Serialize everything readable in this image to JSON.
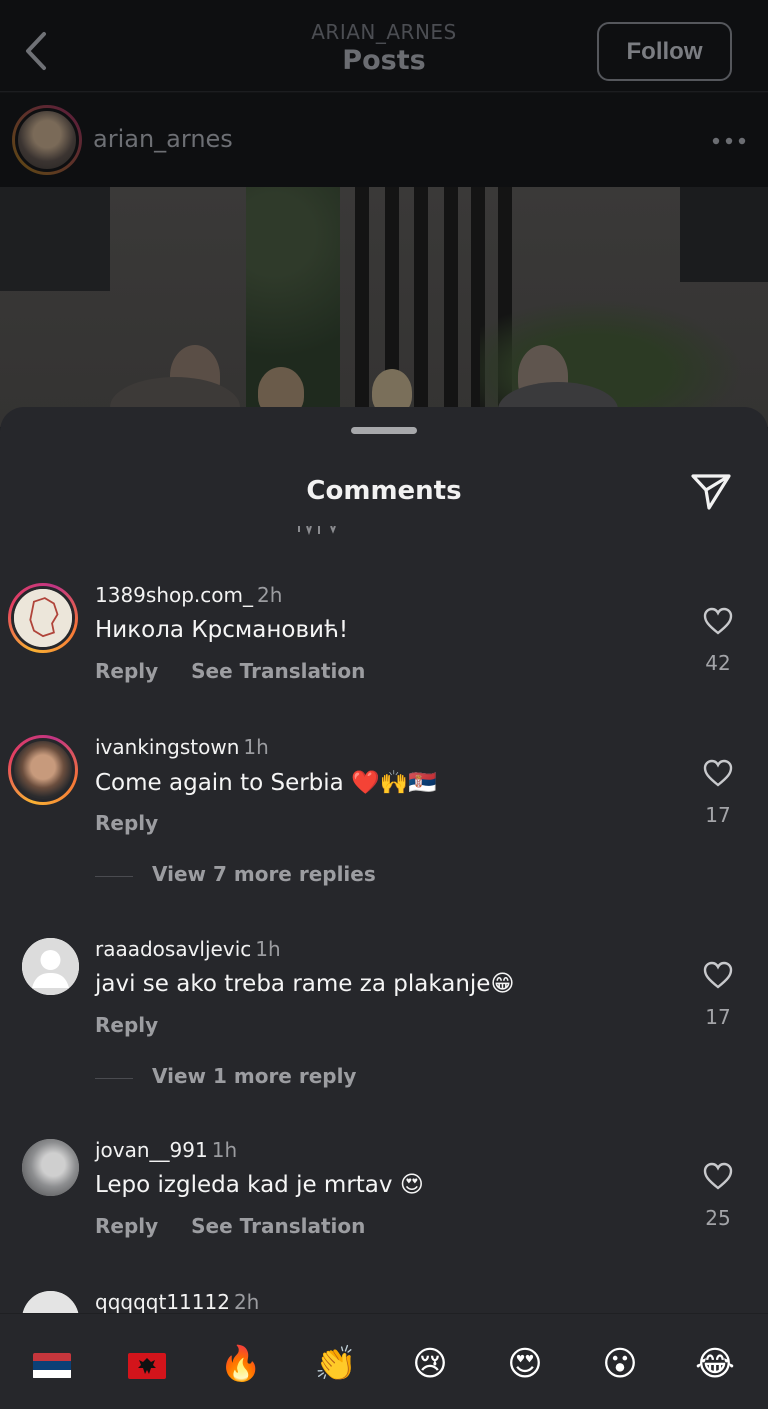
{
  "header": {
    "account_handle": "ARIAN_ARNES",
    "title": "Posts",
    "follow_label": "Follow"
  },
  "post": {
    "username": "arian_arnes"
  },
  "comments_sheet": {
    "title": "Comments",
    "comments": [
      {
        "username": "1389shop.com_",
        "time": "2h",
        "text": "Никола Крсмановић!",
        "actions": [
          "Reply",
          "See Translation"
        ],
        "likes": "42"
      },
      {
        "username": "ivankingstown",
        "time": "1h",
        "text": "Come again to Serbia ❤️🙌🇷🇸",
        "actions": [
          "Reply"
        ],
        "likes": "17",
        "more_replies": "View 7 more replies"
      },
      {
        "username": "raaadosavljevic",
        "time": "1h",
        "text": "javi se ako treba rame za plakanje😁",
        "actions": [
          "Reply"
        ],
        "likes": "17",
        "more_replies": "View 1 more reply"
      },
      {
        "username": "jovan__991",
        "time": "1h",
        "text": "Lepo izgleda kad je mrtav 😍",
        "actions": [
          "Reply",
          "See Translation"
        ],
        "likes": "25"
      },
      {
        "username": "qqqqqt11112",
        "time": "2h"
      }
    ]
  },
  "emoji_bar": {
    "emojis": [
      "🇷🇸",
      "🇦🇱",
      "🔥",
      "👏",
      "😢",
      "😍",
      "😮",
      "😂"
    ]
  },
  "icons": {
    "back": "chevron-left-icon",
    "more": "more-horizontal-icon",
    "share": "send-icon",
    "like": "heart-outline-icon"
  },
  "colors": {
    "sheet_background": "#26272b",
    "story_ring": "#e4405f"
  }
}
